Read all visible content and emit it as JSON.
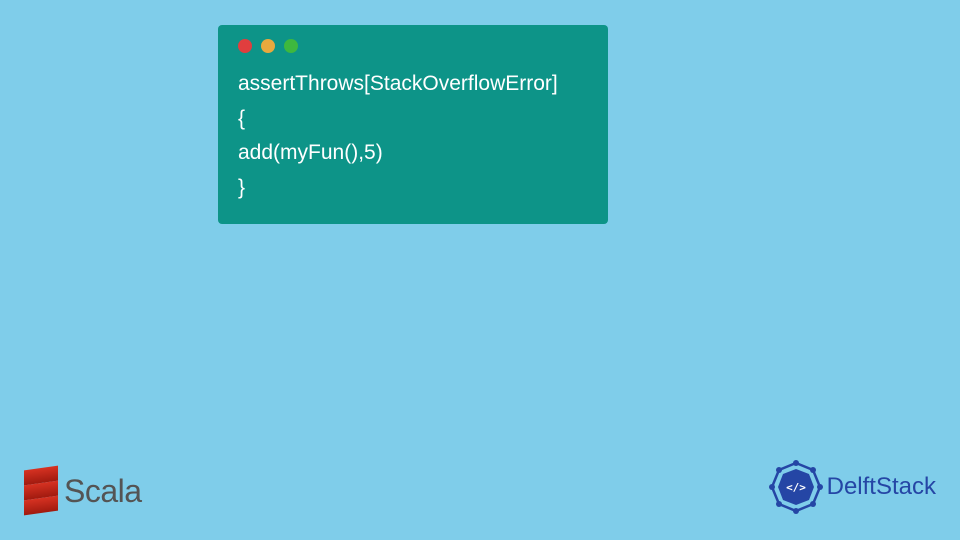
{
  "code": {
    "lines": [
      "assertThrows[StackOverflowError]",
      "{",
      "add(myFun(),5)",
      "}"
    ]
  },
  "logos": {
    "scala": {
      "text": "Scala",
      "color": "#d73222"
    },
    "delftstack": {
      "text": "DelftStack",
      "color": "#2546a5"
    }
  },
  "window_controls": {
    "red": "#e03e3e",
    "yellow": "#e8a93e",
    "green": "#3eb83e"
  }
}
